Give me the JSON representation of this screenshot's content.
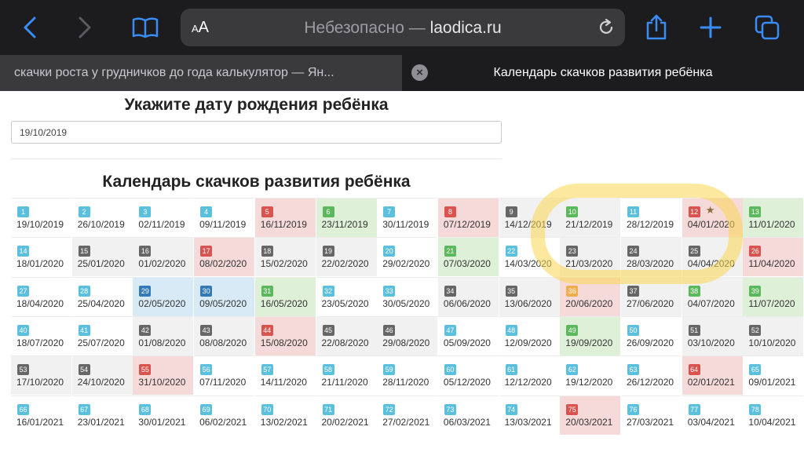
{
  "browser": {
    "text_size_label": "AA",
    "address_prefix": "Небезопасно —",
    "address_host": "laodica.ru",
    "tabs": [
      {
        "title": "скачки роста у грудничков до года калькулятор — Ян..."
      },
      {
        "title": "Календарь скачков развития ребёнка"
      }
    ],
    "icons": [
      "back-icon",
      "forward-icon",
      "bookmarks-icon",
      "reload-icon",
      "share-icon",
      "new-tab-icon",
      "tabs-icon",
      "close-tab-icon"
    ]
  },
  "page": {
    "birth_heading": "Укажите дату рождения ребёнка",
    "birth_date_value": "19/10/2019",
    "calendar_heading": "Календарь скачков развития ребёнка"
  },
  "colors": {
    "blue": "#5bc0de",
    "red": "#d9534f",
    "green": "#5cb85c",
    "gray": "#666666",
    "dark": "#337ab7",
    "orange": "#f0ad4e",
    "highlight": "#fad750"
  },
  "weeks": [
    {
      "n": "1",
      "date": "19/10/2019",
      "badge": "blue",
      "bg": ""
    },
    {
      "n": "2",
      "date": "26/10/2019",
      "badge": "blue",
      "bg": ""
    },
    {
      "n": "3",
      "date": "02/11/2019",
      "badge": "blue",
      "bg": ""
    },
    {
      "n": "4",
      "date": "09/11/2019",
      "badge": "blue",
      "bg": ""
    },
    {
      "n": "5",
      "date": "16/11/2019",
      "badge": "red",
      "bg": "red"
    },
    {
      "n": "6",
      "date": "23/11/2019",
      "badge": "green",
      "bg": "green"
    },
    {
      "n": "7",
      "date": "30/11/2019",
      "badge": "blue",
      "bg": ""
    },
    {
      "n": "8",
      "date": "07/12/2019",
      "badge": "red",
      "bg": "red"
    },
    {
      "n": "9",
      "date": "14/12/2019",
      "badge": "gray",
      "bg": "gray"
    },
    {
      "n": "10",
      "date": "21/12/2019",
      "badge": "green",
      "bg": "gray"
    },
    {
      "n": "11",
      "date": "28/12/2019",
      "badge": "blue",
      "bg": ""
    },
    {
      "n": "12",
      "date": "04/01/2020",
      "badge": "red",
      "bg": "red",
      "star": "★"
    },
    {
      "n": "13",
      "date": "11/01/2020",
      "badge": "green",
      "bg": "green"
    },
    {
      "n": "14",
      "date": "18/01/2020",
      "badge": "blue",
      "bg": ""
    },
    {
      "n": "15",
      "date": "25/01/2020",
      "badge": "gray",
      "bg": "gray"
    },
    {
      "n": "16",
      "date": "01/02/2020",
      "badge": "gray",
      "bg": "gray"
    },
    {
      "n": "17",
      "date": "08/02/2020",
      "badge": "red",
      "bg": "red"
    },
    {
      "n": "18",
      "date": "15/02/2020",
      "badge": "gray",
      "bg": "gray"
    },
    {
      "n": "19",
      "date": "22/02/2020",
      "badge": "gray",
      "bg": "gray"
    },
    {
      "n": "20",
      "date": "29/02/2020",
      "badge": "blue",
      "bg": ""
    },
    {
      "n": "21",
      "date": "07/03/2020",
      "badge": "green",
      "bg": "green"
    },
    {
      "n": "22",
      "date": "14/03/2020",
      "badge": "blue",
      "bg": ""
    },
    {
      "n": "23",
      "date": "21/03/2020",
      "badge": "gray",
      "bg": "gray"
    },
    {
      "n": "24",
      "date": "28/03/2020",
      "badge": "gray",
      "bg": "gray"
    },
    {
      "n": "25",
      "date": "04/04/2020",
      "badge": "gray",
      "bg": "gray"
    },
    {
      "n": "26",
      "date": "11/04/2020",
      "badge": "red",
      "bg": "red"
    },
    {
      "n": "27",
      "date": "18/04/2020",
      "badge": "blue",
      "bg": ""
    },
    {
      "n": "28",
      "date": "25/04/2020",
      "badge": "blue",
      "bg": ""
    },
    {
      "n": "29",
      "date": "02/05/2020",
      "badge": "dark",
      "bg": "blue"
    },
    {
      "n": "30",
      "date": "09/05/2020",
      "badge": "dark",
      "bg": "blue"
    },
    {
      "n": "31",
      "date": "16/05/2020",
      "badge": "green",
      "bg": "green"
    },
    {
      "n": "32",
      "date": "23/05/2020",
      "badge": "blue",
      "bg": ""
    },
    {
      "n": "33",
      "date": "30/05/2020",
      "badge": "blue",
      "bg": ""
    },
    {
      "n": "34",
      "date": "06/06/2020",
      "badge": "gray",
      "bg": "gray"
    },
    {
      "n": "35",
      "date": "13/06/2020",
      "badge": "gray",
      "bg": "gray"
    },
    {
      "n": "36",
      "date": "20/06/2020",
      "badge": "orange",
      "bg": "red"
    },
    {
      "n": "37",
      "date": "27/06/2020",
      "badge": "gray",
      "bg": "gray"
    },
    {
      "n": "38",
      "date": "04/07/2020",
      "badge": "green",
      "bg": "gray"
    },
    {
      "n": "39",
      "date": "11/07/2020",
      "badge": "green",
      "bg": "green"
    },
    {
      "n": "40",
      "date": "18/07/2020",
      "badge": "blue",
      "bg": ""
    },
    {
      "n": "41",
      "date": "25/07/2020",
      "badge": "blue",
      "bg": ""
    },
    {
      "n": "42",
      "date": "01/08/2020",
      "badge": "gray",
      "bg": "gray"
    },
    {
      "n": "43",
      "date": "08/08/2020",
      "badge": "gray",
      "bg": "gray"
    },
    {
      "n": "44",
      "date": "15/08/2020",
      "badge": "red",
      "bg": "red"
    },
    {
      "n": "45",
      "date": "22/08/2020",
      "badge": "gray",
      "bg": "gray"
    },
    {
      "n": "46",
      "date": "29/08/2020",
      "badge": "gray",
      "bg": "gray"
    },
    {
      "n": "47",
      "date": "05/09/2020",
      "badge": "blue",
      "bg": ""
    },
    {
      "n": "48",
      "date": "12/09/2020",
      "badge": "blue",
      "bg": ""
    },
    {
      "n": "49",
      "date": "19/09/2020",
      "badge": "green",
      "bg": "green"
    },
    {
      "n": "50",
      "date": "26/09/2020",
      "badge": "blue",
      "bg": ""
    },
    {
      "n": "51",
      "date": "03/10/2020",
      "badge": "gray",
      "bg": "gray"
    },
    {
      "n": "52",
      "date": "10/10/2020",
      "badge": "gray",
      "bg": "gray"
    },
    {
      "n": "53",
      "date": "17/10/2020",
      "badge": "gray",
      "bg": "gray"
    },
    {
      "n": "54",
      "date": "24/10/2020",
      "badge": "gray",
      "bg": "gray"
    },
    {
      "n": "55",
      "date": "31/10/2020",
      "badge": "red",
      "bg": "red"
    },
    {
      "n": "56",
      "date": "07/11/2020",
      "badge": "blue",
      "bg": ""
    },
    {
      "n": "57",
      "date": "14/11/2020",
      "badge": "blue",
      "bg": ""
    },
    {
      "n": "58",
      "date": "21/11/2020",
      "badge": "blue",
      "bg": ""
    },
    {
      "n": "59",
      "date": "28/11/2020",
      "badge": "blue",
      "bg": ""
    },
    {
      "n": "60",
      "date": "05/12/2020",
      "badge": "blue",
      "bg": ""
    },
    {
      "n": "61",
      "date": "12/12/2020",
      "badge": "blue",
      "bg": ""
    },
    {
      "n": "62",
      "date": "19/12/2020",
      "badge": "blue",
      "bg": ""
    },
    {
      "n": "63",
      "date": "26/12/2020",
      "badge": "blue",
      "bg": ""
    },
    {
      "n": "64",
      "date": "02/01/2021",
      "badge": "red",
      "bg": "red"
    },
    {
      "n": "65",
      "date": "09/01/2021",
      "badge": "blue",
      "bg": ""
    },
    {
      "n": "66",
      "date": "16/01/2021",
      "badge": "blue",
      "bg": ""
    },
    {
      "n": "67",
      "date": "23/01/2021",
      "badge": "blue",
      "bg": ""
    },
    {
      "n": "68",
      "date": "30/01/2021",
      "badge": "blue",
      "bg": ""
    },
    {
      "n": "69",
      "date": "06/02/2021",
      "badge": "blue",
      "bg": ""
    },
    {
      "n": "70",
      "date": "13/02/2021",
      "badge": "blue",
      "bg": ""
    },
    {
      "n": "71",
      "date": "20/02/2021",
      "badge": "blue",
      "bg": ""
    },
    {
      "n": "72",
      "date": "27/02/2021",
      "badge": "blue",
      "bg": ""
    },
    {
      "n": "73",
      "date": "06/03/2021",
      "badge": "blue",
      "bg": ""
    },
    {
      "n": "74",
      "date": "13/03/2021",
      "badge": "blue",
      "bg": ""
    },
    {
      "n": "75",
      "date": "20/03/2021",
      "badge": "red",
      "bg": "red"
    },
    {
      "n": "76",
      "date": "27/03/2021",
      "badge": "blue",
      "bg": ""
    },
    {
      "n": "77",
      "date": "03/04/2021",
      "badge": "blue",
      "bg": ""
    },
    {
      "n": "78",
      "date": "10/04/2021",
      "badge": "blue",
      "bg": ""
    }
  ]
}
